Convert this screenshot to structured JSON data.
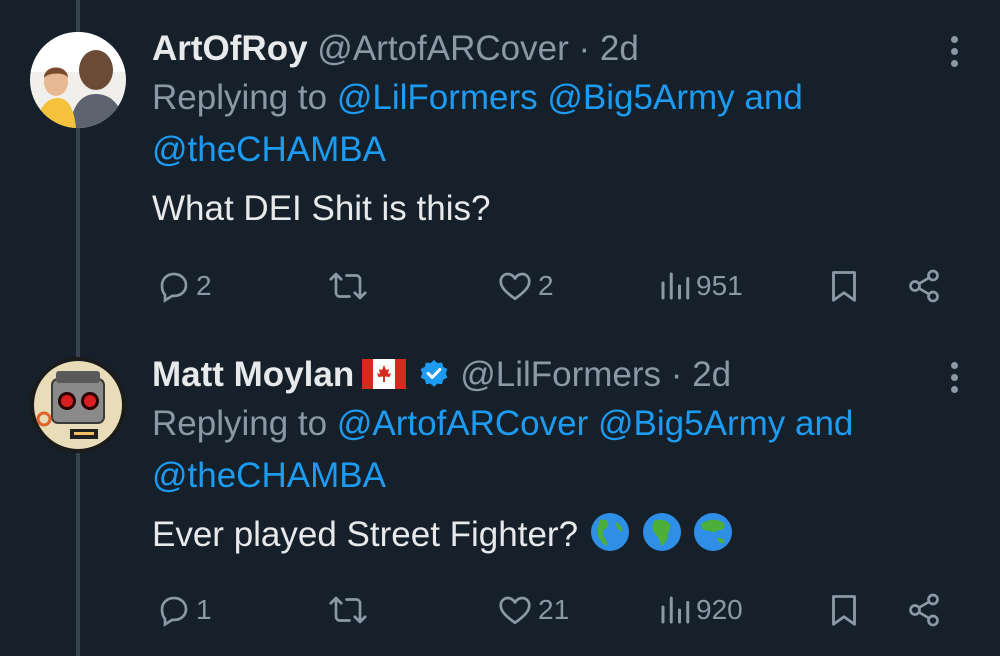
{
  "tweets": [
    {
      "name": "ArtOfRoy",
      "handle": "@ArtofARCover",
      "separator": "·",
      "time": "2d",
      "reply_prefix": "Replying to",
      "mentions": [
        "@LilFormers",
        "@Big5Army"
      ],
      "reply_and": "and",
      "mention_last": "@theCHAMBA",
      "text": "What DEI Shit is this?",
      "replies": "2",
      "reposts": "",
      "likes": "2",
      "views": "951",
      "flag_icon": "",
      "verified": false
    },
    {
      "name": "Matt Moylan",
      "handle": "@LilFormers",
      "separator": "·",
      "time": "2d",
      "reply_prefix": "Replying to",
      "mentions": [
        "@ArtofARCover",
        "@Big5Army"
      ],
      "reply_and": "and",
      "mention_last": "@theCHAMBA",
      "text": "Ever played Street Fighter?",
      "text_emoji": [
        "globe-americas-icon",
        "globe-africa-icon",
        "globe-asia-icon"
      ],
      "replies": "1",
      "reposts": "",
      "likes": "21",
      "views": "920",
      "flag_icon": "canada-flag-icon",
      "verified": true
    }
  ],
  "colors": {
    "background": "#15202b",
    "link": "#1d9bf0",
    "muted": "#8b98a5",
    "text": "#e7e9ea"
  }
}
